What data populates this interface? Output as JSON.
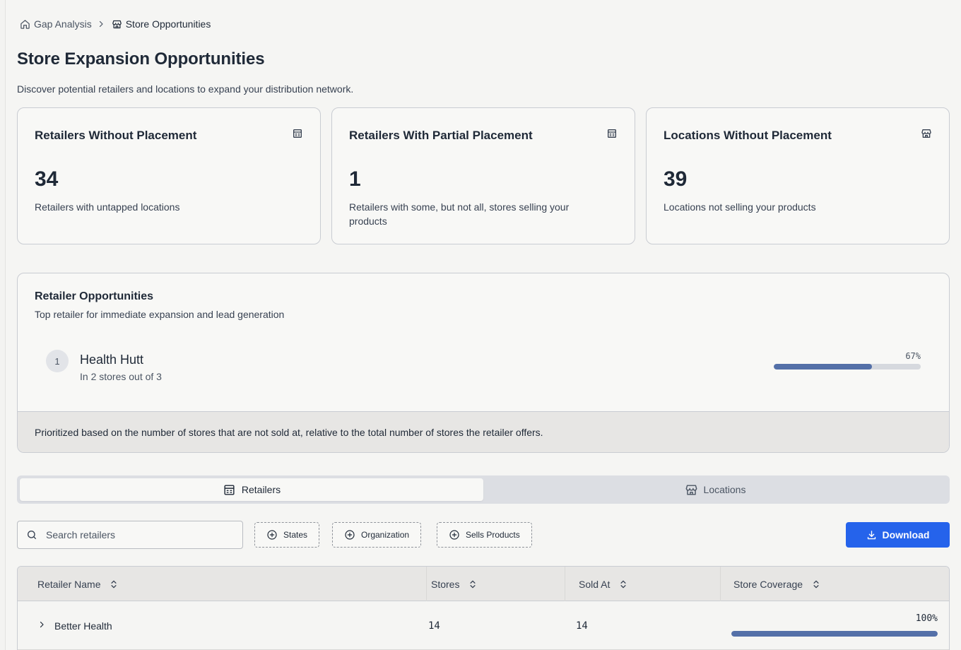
{
  "breadcrumb": {
    "items": [
      {
        "label": "Gap Analysis",
        "icon": "home-icon"
      },
      {
        "label": "Store Opportunities",
        "icon": "store-icon"
      }
    ]
  },
  "page": {
    "title": "Store Expansion Opportunities",
    "subtitle": "Discover potential retailers and locations to expand your distribution network."
  },
  "stats": [
    {
      "title": "Retailers Without Placement",
      "value": "34",
      "description": "Retailers with untapped locations",
      "icon": "building-icon"
    },
    {
      "title": "Retailers With Partial Placement",
      "value": "1",
      "description": "Retailers with some, but not all, stores selling your products",
      "icon": "building-icon"
    },
    {
      "title": "Locations Without Placement",
      "value": "39",
      "description": "Locations not selling your products",
      "icon": "store-icon"
    }
  ],
  "opportunities": {
    "title": "Retailer Opportunities",
    "subtitle": "Top retailer for immediate expansion and lead generation",
    "items": [
      {
        "rank": "1",
        "name": "Health Hutt",
        "detail": "In 2 stores out of 3",
        "percent_label": "67%",
        "percent": 0.67
      }
    ],
    "footer": "Prioritized based on the number of stores that are not sold at, relative to the total number of stores the retailer offers."
  },
  "tabs": [
    {
      "label": "Retailers",
      "icon": "building-icon",
      "active": true
    },
    {
      "label": "Locations",
      "icon": "store-icon",
      "active": false
    }
  ],
  "search": {
    "placeholder": "Search retailers",
    "value": ""
  },
  "filters": [
    {
      "label": "States"
    },
    {
      "label": "Organization"
    },
    {
      "label": "Sells Products"
    }
  ],
  "download_label": "Download",
  "table": {
    "columns": [
      "Retailer Name",
      "Stores",
      "Sold At",
      "Store Coverage"
    ],
    "rows": [
      {
        "name": "Better Health",
        "stores": "14",
        "sold_at": "14",
        "coverage_label": "100%",
        "coverage": 1.0
      }
    ]
  },
  "colors": {
    "accent": "#2563eb",
    "progress": "#5470a8",
    "track": "#d6d9de"
  }
}
